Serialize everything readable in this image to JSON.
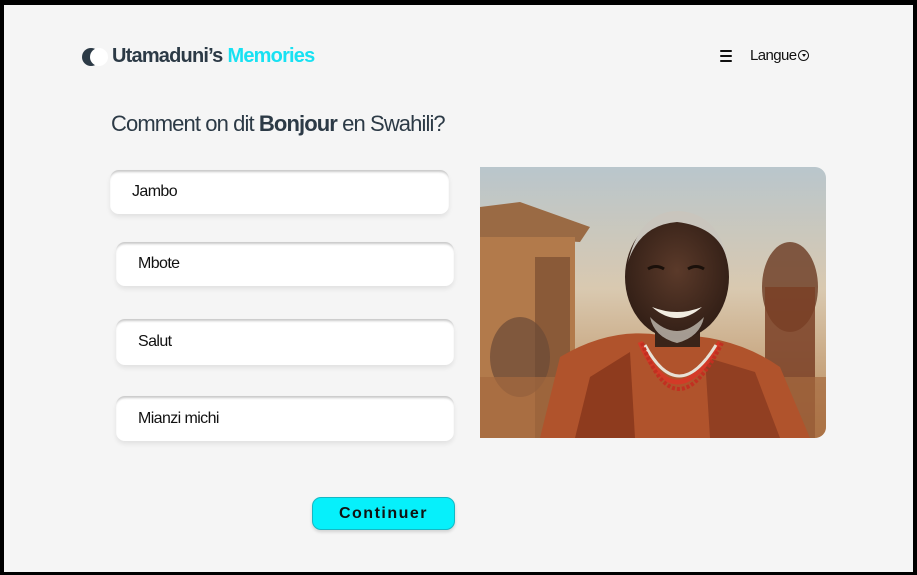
{
  "header": {
    "brand_name": "Utamaduni’s",
    "brand_accent": "Memories",
    "menu_icon": "hamburger-icon",
    "language_label": "Langue",
    "language_icon": "chevron-down-circle-icon"
  },
  "quiz": {
    "question_prefix": "Comment on dit",
    "question_word": "Bonjour",
    "question_suffix": "en Swahili?",
    "answers": [
      "Jambo",
      "Mbote",
      "Salut",
      "Mianzi michi"
    ],
    "continue_label": "Continuer"
  },
  "colors": {
    "accent": "#18e1f2",
    "button": "#06f0fb",
    "text_dark": "#2c3a46",
    "background": "#f5f5f5"
  }
}
